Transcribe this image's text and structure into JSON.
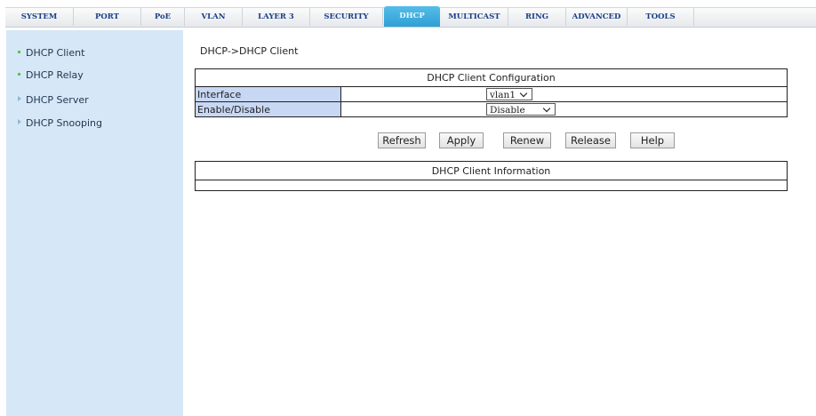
{
  "nav": {
    "tabs": [
      "SYSTEM",
      "PORT",
      "PoE",
      "VLAN",
      "LAYER 3",
      "SECURITY",
      "DHCP",
      "MULTICAST",
      "RING",
      "ADVANCED",
      "TOOLS"
    ],
    "active": "DHCP"
  },
  "sidebar": {
    "items": [
      {
        "label": "DHCP Client",
        "bullet": "green"
      },
      {
        "label": "DHCP Relay",
        "bullet": "green"
      },
      {
        "label": "DHCP Server",
        "bullet": "arrow"
      },
      {
        "label": "DHCP Snooping",
        "bullet": "arrow"
      }
    ]
  },
  "breadcrumb": "DHCP->DHCP Client",
  "config": {
    "title": "DHCP Client Configuration",
    "interface_label": "Interface",
    "interface_value": "vlan1",
    "enable_label": "Enable/Disable",
    "enable_value": "Disable"
  },
  "buttons": {
    "refresh": "Refresh",
    "apply": "Apply",
    "renew": "Renew",
    "release": "Release",
    "help": "Help"
  },
  "info": {
    "title": "DHCP Client Information"
  },
  "colors": {
    "sidebar_bg": "#d6e8f7",
    "active_tab": "#3aa9db",
    "label_cell": "#c7d7f4",
    "nav_text": "#1a3f8a"
  }
}
